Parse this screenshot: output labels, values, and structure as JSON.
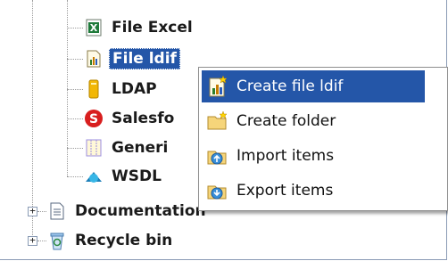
{
  "tree": {
    "nodes": [
      {
        "label": "File Excel",
        "icon": "excel-file-icon"
      },
      {
        "label": "File ldif",
        "icon": "ldif-file-icon",
        "selected": true
      },
      {
        "label": "LDAP",
        "icon": "ldap-icon"
      },
      {
        "label": "Salesfo",
        "icon": "salesforce-icon"
      },
      {
        "label": "Generi",
        "icon": "generic-schema-icon"
      },
      {
        "label": "WSDL",
        "icon": "wsdl-icon"
      },
      {
        "label": "Documentation",
        "icon": "documentation-icon"
      },
      {
        "label": "Recycle bin",
        "icon": "recycle-bin-icon"
      }
    ]
  },
  "context_menu": {
    "items": [
      {
        "label": "Create file ldif",
        "icon": "create-file-ldif-icon",
        "active": true
      },
      {
        "label": "Create folder",
        "icon": "create-folder-icon"
      },
      {
        "label": "Import items",
        "icon": "import-items-icon"
      },
      {
        "label": "Export items",
        "icon": "export-items-icon"
      }
    ]
  },
  "colors": {
    "selection": "#2456a8",
    "tree_line": "#9a9a9a"
  }
}
